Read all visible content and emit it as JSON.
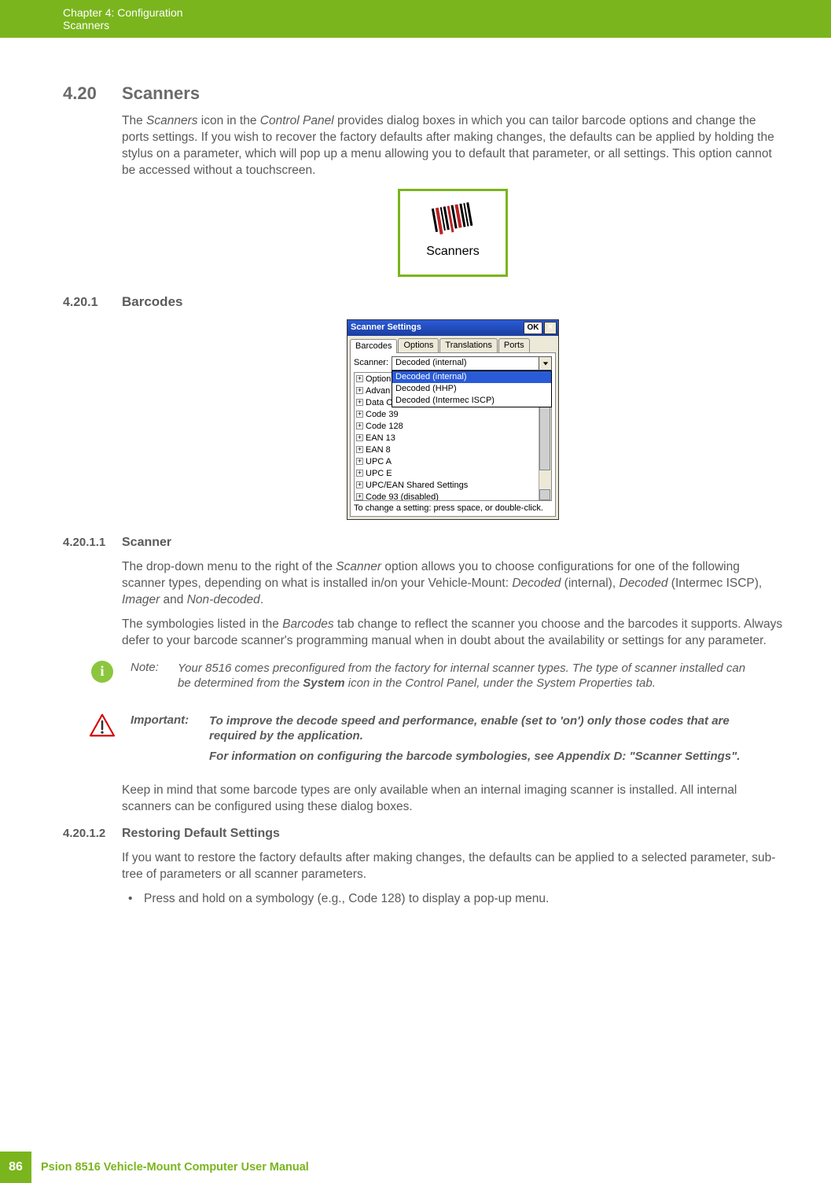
{
  "header": {
    "chapter": "Chapter 4: Configuration",
    "section": "Scanners"
  },
  "s420": {
    "num": "4.20",
    "title": "Scanners",
    "p1_a": "The ",
    "p1_b": "Scanners",
    "p1_c": " icon in the ",
    "p1_d": "Control Panel",
    "p1_e": " provides dialog boxes in which you can tailor barcode options and change the ports settings. If you wish to recover the factory defaults after making changes, the defaults can be applied by holding the stylus on a parameter, which will pop up a menu allowing you to default that parameter, or all settings. This option cannot be accessed without a touchscreen.",
    "icon_label": "Scanners"
  },
  "s4201": {
    "num": "4.20.1",
    "title": "Barcodes",
    "win": {
      "title": "Scanner Settings",
      "ok": "OK",
      "close": "×",
      "tabs": [
        "Barcodes",
        "Options",
        "Translations",
        "Ports"
      ],
      "scanner_label": "Scanner:",
      "scanner_selected": "Decoded (internal)",
      "scanner_options": [
        "Decoded (internal)",
        "Decoded (HHP)",
        "Decoded (Intermec ISCP)"
      ],
      "tree": [
        "Option",
        "Advan",
        "Data Options",
        "Code 39",
        "Code 128",
        "EAN 13",
        "EAN 8",
        "UPC A",
        "UPC E",
        "UPC/EAN Shared Settings",
        "Code 93 (disabled)"
      ],
      "hint": "To change a setting: press space, or double-click."
    }
  },
  "s42011": {
    "num": "4.20.1.1",
    "title": "Scanner",
    "p1_a": "The drop-down menu to the right of the ",
    "p1_b": "Scanner",
    "p1_c": " option allows you to choose configurations for one of the following scanner types, depending on what is installed in/on your Vehicle-Mount: ",
    "p1_d": "Decoded",
    "p1_e": " (internal), ",
    "p1_f": "Decoded",
    "p1_g": " (Intermec ISCP), ",
    "p1_h": "Imager",
    "p1_i": " and ",
    "p1_j": "Non-decoded",
    "p1_k": ".",
    "p2_a": "The symbologies listed in the ",
    "p2_b": "Barcodes",
    "p2_c": " tab change to reflect the scanner you choose and the barcodes it supports. Always defer to your barcode scanner's programming manual when in doubt about the availability or settings for any parameter.",
    "note_label": "Note:",
    "note_a": "Your 8516 comes preconfigured from the factory for internal scanner types. The type of scanner installed can be determined from the ",
    "note_b": "System",
    "note_c": " icon in the Control Panel, under the System Properties tab.",
    "important_label": "Important:",
    "important_1": "To improve the decode speed and performance, enable (set to 'on') only those codes that are required by the application.",
    "important_2": "For information on configuring the barcode symbologies, see Appendix D: \"Scanner Settings\".",
    "p3": "Keep in mind that some barcode types are only available when an internal imaging scanner is installed. All internal scanners can be configured using these dialog boxes."
  },
  "s42012": {
    "num": "4.20.1.2",
    "title": "Restoring Default Settings",
    "p1": "If you want to restore the factory defaults after making changes, the defaults can be applied to a selected parameter, sub-tree of parameters or all scanner parameters.",
    "li1": "Press and hold on a symbology (e.g., Code 128) to display a pop-up menu."
  },
  "footer": {
    "page": "86",
    "title": "Psion 8516 Vehicle-Mount Computer User Manual"
  }
}
